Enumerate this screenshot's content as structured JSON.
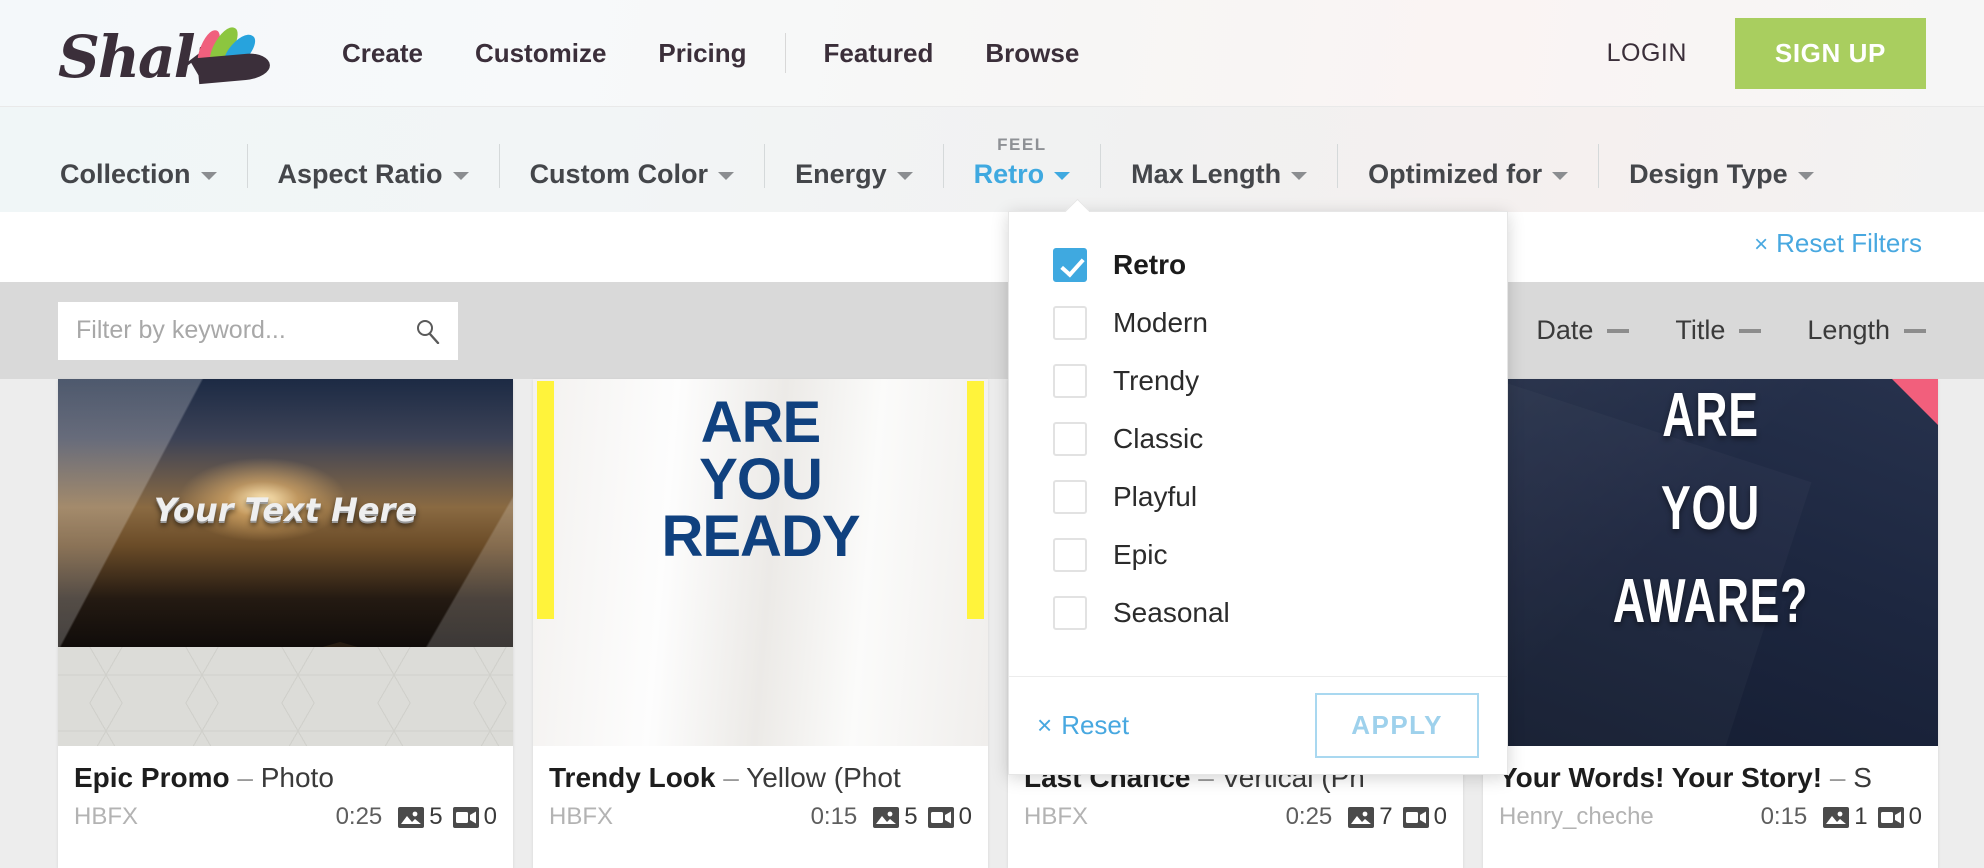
{
  "header": {
    "logo_text": "Shakr",
    "nav_links": [
      "Create",
      "Customize",
      "Pricing"
    ],
    "nav_links_secondary": [
      "Featured",
      "Browse"
    ],
    "login_label": "LOGIN",
    "signup_label": "SIGN UP",
    "signup_color": "#a9ce5f"
  },
  "filters": {
    "items": [
      {
        "label": "Collection",
        "eyebrow": "",
        "active": false
      },
      {
        "label": "Aspect Ratio",
        "eyebrow": "",
        "active": false
      },
      {
        "label": "Custom Color",
        "eyebrow": "",
        "active": false
      },
      {
        "label": "Energy",
        "eyebrow": "",
        "active": false
      },
      {
        "label": "Retro",
        "eyebrow": "FEEL",
        "active": true
      },
      {
        "label": "Max Length",
        "eyebrow": "",
        "active": false
      },
      {
        "label": "Optimized for",
        "eyebrow": "",
        "active": false
      },
      {
        "label": "Design Type",
        "eyebrow": "",
        "active": false
      }
    ],
    "reset_filters_label": "Reset Filters",
    "reset_x": "×",
    "accent_color": "#3fa9e0"
  },
  "dropdown": {
    "options": [
      {
        "label": "Retro",
        "checked": true
      },
      {
        "label": "Modern",
        "checked": false
      },
      {
        "label": "Trendy",
        "checked": false
      },
      {
        "label": "Classic",
        "checked": false
      },
      {
        "label": "Playful",
        "checked": false
      },
      {
        "label": "Epic",
        "checked": false
      },
      {
        "label": "Seasonal",
        "checked": false
      }
    ],
    "reset_label": "Reset",
    "reset_x": "×",
    "apply_label": "APPLY"
  },
  "search": {
    "value": "",
    "placeholder": "Filter by keyword..."
  },
  "sorts": [
    {
      "label": "Date"
    },
    {
      "label": "Title"
    },
    {
      "label": "Length"
    }
  ],
  "cards": [
    {
      "title_main": "Epic Promo",
      "title_dash": "–",
      "title_sub": "Photo",
      "author": "HBFX",
      "duration": "0:25",
      "photo_count": "5",
      "video_count": "0",
      "thumb_text": "Your Text Here"
    },
    {
      "title_main": "Trendy Look",
      "title_dash": "–",
      "title_sub": "Yellow (Phot",
      "author": "HBFX",
      "duration": "0:15",
      "photo_count": "5",
      "video_count": "0",
      "thumb_text": "ARE YOU READY"
    },
    {
      "title_main": "Last Chance",
      "title_dash": "–",
      "title_sub": "Vertical (Ph",
      "author": "HBFX",
      "duration": "0:25",
      "photo_count": "7",
      "video_count": "0",
      "thumb_text": ""
    },
    {
      "title_main": "Your Words! Your Story!",
      "title_dash": "–",
      "title_sub": "S",
      "author": "Henry_cheche",
      "duration": "0:15",
      "photo_count": "1",
      "video_count": "0",
      "thumb_text": "ARE YOU AWARE?"
    }
  ]
}
